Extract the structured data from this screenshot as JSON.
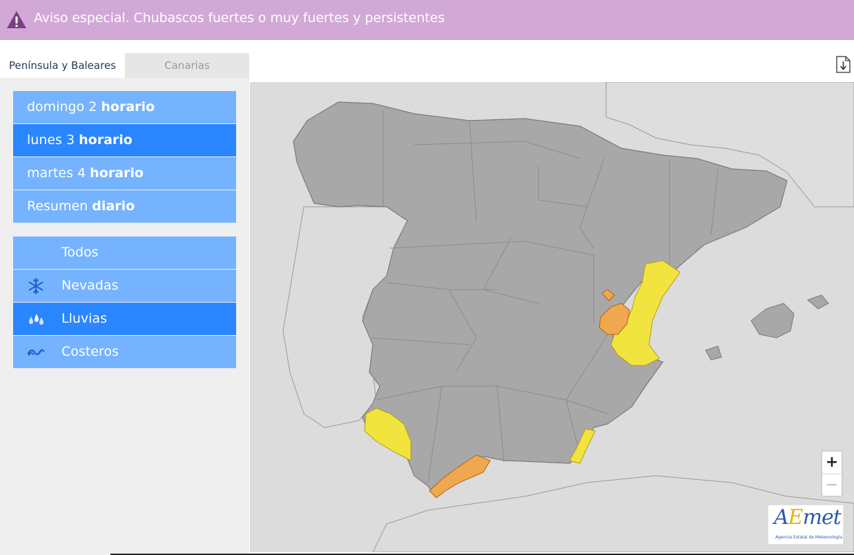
{
  "banner": {
    "title": "Aviso especial. Chubascos fuertes o muy fuertes y persistentes",
    "color": "#d2a8d6",
    "icon": "warning-triangle-icon"
  },
  "tabs": [
    {
      "label": "Península y Baleares",
      "active": true
    },
    {
      "label": "Canarias",
      "active": false
    }
  ],
  "days": [
    {
      "prefix": "domingo 2 ",
      "bold": "horario",
      "selected": false
    },
    {
      "prefix": "lunes 3 ",
      "bold": "horario",
      "selected": true
    },
    {
      "prefix": "martes 4 ",
      "bold": "horario",
      "selected": false
    },
    {
      "prefix": "Resumen ",
      "bold": "diario",
      "selected": false
    }
  ],
  "phenomena": [
    {
      "label": "Todos",
      "icon": "",
      "selected": false
    },
    {
      "label": "Nevadas",
      "icon": "snowflake-icon",
      "selected": false
    },
    {
      "label": "Lluvias",
      "icon": "raindrops-icon",
      "selected": true
    },
    {
      "label": "Costeros",
      "icon": "waves-icon",
      "selected": false
    }
  ],
  "map": {
    "warning_colors": {
      "yellow": "#f1e43e",
      "orange": "#f0a850",
      "none": "#a8a8a8"
    },
    "zoom": {
      "in": "+",
      "out": "−"
    },
    "download_icon": "download-arrow-icon"
  },
  "logo": {
    "text_a": "A",
    "text_e": "E",
    "text_rest": "met",
    "subtitle": "Agencia Estatal de Meteorología"
  },
  "colors": {
    "item": "#75b3ff",
    "item_selected": "#2a86ff"
  }
}
